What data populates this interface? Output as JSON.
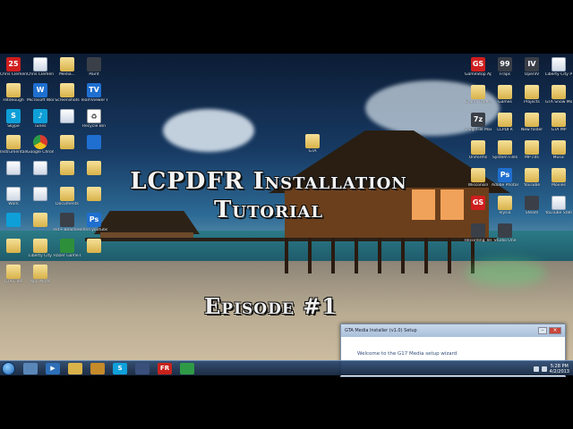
{
  "video_title": {
    "line1": "LCPDFR Installation",
    "line2": "Tutorial",
    "episode": "Episode #1"
  },
  "desktop_icons_left": [
    {
      "name": "chris-clement-icon",
      "label": "Chris Clement...",
      "kind": "red",
      "glyph": "25"
    },
    {
      "name": "chris-clement-doc-icon",
      "label": "Chris Clement...",
      "kind": "doc",
      "glyph": ""
    },
    {
      "name": "media-folder-icon",
      "label": "Media...",
      "kind": "folder",
      "glyph": ""
    },
    {
      "name": "paint-icon",
      "label": "Paint",
      "kind": "dark",
      "glyph": ""
    },
    {
      "name": "hitdeough-folder-icon",
      "label": "Hitdeough",
      "kind": "folder",
      "glyph": ""
    },
    {
      "name": "microsoft-word-icon",
      "label": "Microsoft Word 2010",
      "kind": "blue",
      "glyph": "W"
    },
    {
      "name": "screenshots-folder-icon",
      "label": "Screenshots",
      "kind": "folder",
      "glyph": ""
    },
    {
      "name": "teamviewer-icon",
      "label": "TeamViewer 8",
      "kind": "blue",
      "glyph": "TV"
    },
    {
      "name": "skype-icon",
      "label": "Skype",
      "kind": "teal",
      "glyph": "S"
    },
    {
      "name": "tunes-icon",
      "label": "Tunes",
      "kind": "teal",
      "glyph": "♪"
    },
    {
      "name": "doc-icon",
      "label": "",
      "kind": "doc",
      "glyph": ""
    },
    {
      "name": "recycle-bin-icon",
      "label": "Recycle Bin",
      "kind": "white",
      "glyph": "♻"
    },
    {
      "name": "instrumentals-folder-icon",
      "label": "Instrumentals",
      "kind": "folder",
      "glyph": ""
    },
    {
      "name": "google-chrome-icon",
      "label": "Google Chrome",
      "kind": "chrome",
      "glyph": ""
    },
    {
      "name": "folder-icon",
      "label": "",
      "kind": "folder",
      "glyph": ""
    },
    {
      "name": "computer-icon",
      "label": "",
      "kind": "blue",
      "glyph": ""
    },
    {
      "name": "doc2-icon",
      "label": "",
      "kind": "doc",
      "glyph": ""
    },
    {
      "name": "shortcut-icon",
      "label": "",
      "kind": "doc",
      "glyph": ""
    },
    {
      "name": "folder2-icon",
      "label": "",
      "kind": "folder",
      "glyph": ""
    },
    {
      "name": "folder3-icon",
      "label": "",
      "kind": "folder",
      "glyph": ""
    },
    {
      "name": "work-doc-icon",
      "label": "Work",
      "kind": "doc",
      "glyph": ""
    },
    {
      "name": "youtube-doc-icon",
      "label": "",
      "kind": "doc",
      "glyph": ""
    },
    {
      "name": "documents-folder-icon",
      "label": "Documents",
      "kind": "folder",
      "glyph": ""
    },
    {
      "name": "folder4-icon",
      "label": "",
      "kind": "folder",
      "glyph": ""
    },
    {
      "name": "app-icon",
      "label": "",
      "kind": "teal",
      "glyph": ""
    },
    {
      "name": "folder5-icon",
      "label": "",
      "kind": "folder",
      "glyph": ""
    },
    {
      "name": "hd-wallpapers-icon",
      "label": "Hd+ Beaches Wallpapers",
      "kind": "dark",
      "glyph": ""
    },
    {
      "name": "photoshop-icon",
      "label": "chris youtube",
      "kind": "blue",
      "glyph": "Ps"
    },
    {
      "name": "folder6-icon",
      "label": "",
      "kind": "folder",
      "glyph": ""
    },
    {
      "name": "liberty-city-folder-icon",
      "label": "Liberty City",
      "kind": "folder",
      "glyph": ""
    },
    {
      "name": "razer-game-booster-icon",
      "label": "Razer Game Booster",
      "kind": "green",
      "glyph": ""
    },
    {
      "name": "folder7-icon",
      "label": "",
      "kind": "folder",
      "glyph": ""
    },
    {
      "name": "gta-folder-icon",
      "label": "GTA Files",
      "kind": "folder",
      "glyph": ""
    },
    {
      "name": "app-mods-folder-icon",
      "label": "App Mods",
      "kind": "folder",
      "glyph": ""
    }
  ],
  "desktop_icons_right": [
    {
      "name": "gamestop-app-icon",
      "label": "GameStop App",
      "kind": "red",
      "glyph": "GS"
    },
    {
      "name": "fraps-icon",
      "label": "Fraps",
      "kind": "dark",
      "glyph": "99"
    },
    {
      "name": "openiv-icon",
      "label": "OpenIV",
      "kind": "dark",
      "glyph": "IV"
    },
    {
      "name": "liberty-city-pd-icon",
      "label": "Liberty City PD",
      "kind": "doc",
      "glyph": ""
    },
    {
      "name": "grand-theft-auto-folder-icon",
      "label": "Grand Theft Auto",
      "kind": "folder",
      "glyph": ""
    },
    {
      "name": "games-folder-icon",
      "label": "Games",
      "kind": "folder",
      "glyph": ""
    },
    {
      "name": "projects-folder-icon",
      "label": "Projects",
      "kind": "folder",
      "glyph": ""
    },
    {
      "name": "gta-snow-mod-folder-icon",
      "label": "GTA Snow Mod",
      "kind": "folder",
      "glyph": ""
    },
    {
      "name": "7zip-icon",
      "label": "7-Zip File Manager",
      "kind": "dark",
      "glyph": "7z"
    },
    {
      "name": "lcpdfr-folder-icon",
      "label": "LCPDFR",
      "kind": "folder",
      "glyph": ""
    },
    {
      "name": "new-folder-icon",
      "label": "New folder",
      "kind": "folder",
      "glyph": ""
    },
    {
      "name": "gta-mp-folder-icon",
      "label": "GTA MP",
      "kind": "folder",
      "glyph": ""
    },
    {
      "name": "uniforms-folder-icon",
      "label": "Uniforms",
      "kind": "folder",
      "glyph": ""
    },
    {
      "name": "system-files-folder-icon",
      "label": "System Files",
      "kind": "folder",
      "glyph": ""
    },
    {
      "name": "mp-cds-folder-icon",
      "label": "MP cds",
      "kind": "folder",
      "glyph": ""
    },
    {
      "name": "music-folder-icon",
      "label": "Music",
      "kind": "folder",
      "glyph": ""
    },
    {
      "name": "wisconsin-folder-icon",
      "label": "Wisconsin",
      "kind": "folder",
      "glyph": ""
    },
    {
      "name": "adobe-photoshop-icon",
      "label": "Adobe Photosh...",
      "kind": "blue",
      "glyph": "Ps"
    },
    {
      "name": "youtube-folder-icon",
      "label": "YouTube",
      "kind": "folder",
      "glyph": ""
    },
    {
      "name": "movies-folder-icon",
      "label": "Movies",
      "kind": "folder",
      "glyph": ""
    },
    {
      "name": "gamestop-icon",
      "label": "",
      "kind": "red",
      "glyph": "GS"
    },
    {
      "name": "elysian-folder-icon",
      "label": "elysia",
      "kind": "folder",
      "glyph": ""
    },
    {
      "name": "steam-icon",
      "label": "Steam",
      "kind": "dark",
      "glyph": ""
    },
    {
      "name": "youtube-stats-icon",
      "label": "YouTube Stats",
      "kind": "doc",
      "glyph": ""
    },
    {
      "name": "recording-template-icon",
      "label": "Recording Template",
      "kind": "dark",
      "glyph": ""
    },
    {
      "name": "studio-one-icon",
      "label": "Studio One",
      "kind": "dark",
      "glyph": ""
    },
    {
      "name": "gta-folder-center-icon",
      "label": "GTA",
      "kind": "folder",
      "glyph": ""
    }
  ],
  "setup_window": {
    "title": "GTA Media Installer (v1.0) Setup",
    "body": "Welcome to the G17 Media setup wizard"
  },
  "taskbar": {
    "items": [
      {
        "name": "explorer-taskbar-icon",
        "glyph": "",
        "color": "#5a87b8"
      },
      {
        "name": "media-player-taskbar-icon",
        "glyph": "▶",
        "color": "#2d6fb8"
      },
      {
        "name": "folder-taskbar-icon",
        "glyph": "",
        "color": "#d9b34a"
      },
      {
        "name": "media-taskbar-icon",
        "glyph": "",
        "color": "#c58a2a"
      },
      {
        "name": "skype-taskbar-icon",
        "glyph": "S",
        "color": "#0fa0da"
      },
      {
        "name": "app-taskbar-icon",
        "glyph": "",
        "color": "#3a4f7a"
      },
      {
        "name": "fraps-taskbar-icon",
        "glyph": "FR",
        "color": "#c8221c"
      },
      {
        "name": "chrome-taskbar-icon",
        "glyph": "",
        "color": "#2f9a46"
      }
    ],
    "time": "5:28 PM",
    "date": "4/2/2013"
  }
}
